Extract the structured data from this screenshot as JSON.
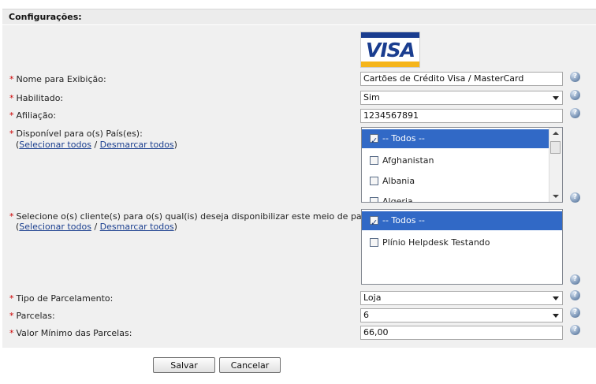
{
  "header": {
    "title": "Configurações:"
  },
  "logo": {
    "text": "VISA",
    "colors": {
      "blue": "#1a3d8f",
      "gold": "#f5b51b"
    }
  },
  "fields": {
    "nome": {
      "label": "Nome para Exibição:",
      "value": "Cartões de Crédito Visa / MasterCard"
    },
    "habilitado": {
      "label": "Habilitado:",
      "value": "Sim"
    },
    "afiliacao": {
      "label": "Afiliação:",
      "value": "1234567891"
    },
    "paises": {
      "label": "Disponível para o(s) País(es):",
      "select_all": "Selecionar todos",
      "separator": "/",
      "deselect_all": "Desmarcar todos",
      "items": [
        {
          "label": "-- Todos --",
          "checked": true
        },
        {
          "label": "Afghanistan",
          "checked": false
        },
        {
          "label": "Albania",
          "checked": false
        },
        {
          "label": "Algeria",
          "checked": false
        }
      ]
    },
    "clientes": {
      "label": "Selecione o(s) cliente(s) para o(s) qual(is) deseja disponibilizar este meio de pagamento.:",
      "select_all": "Selecionar todos",
      "separator": "/",
      "deselect_all": "Desmarcar todos",
      "items": [
        {
          "label": "-- Todos --",
          "checked": true
        },
        {
          "label": "Plínio Helpdesk Testando",
          "checked": false
        }
      ]
    },
    "tipo_parcelamento": {
      "label": "Tipo de Parcelamento:",
      "value": "Loja"
    },
    "parcelas": {
      "label": "Parcelas:",
      "value": "6"
    },
    "valor_minimo": {
      "label": "Valor Mínimo das Parcelas:",
      "value": "66,00"
    }
  },
  "required_mark": "*",
  "buttons": {
    "save": "Salvar",
    "cancel": "Cancelar"
  },
  "icons": {
    "help": "help-icon",
    "checkbox": "checkbox-icon",
    "dropdown": "chevron-down-icon"
  },
  "colors": {
    "selection": "#3169c6",
    "required": "#cc0000",
    "link": "#1b3f8f"
  }
}
